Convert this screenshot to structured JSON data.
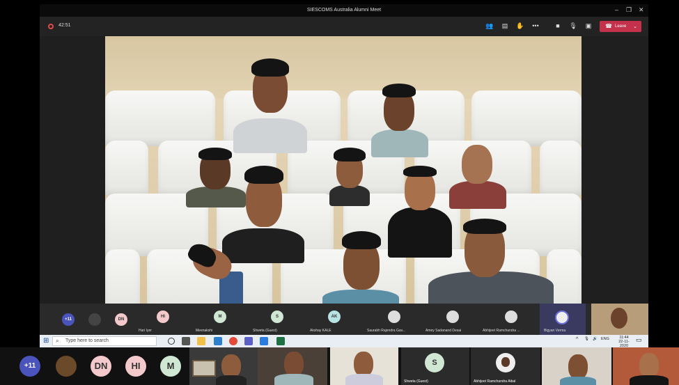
{
  "window": {
    "title": "SIESCOMS Australia Alumni Meet",
    "timer": "42:51",
    "leave_label": "Leave"
  },
  "strip": {
    "overflow": "+11",
    "participants": [
      {
        "initials": "DN",
        "name": ""
      },
      {
        "initials": "HI",
        "name": "Hari Iyer"
      },
      {
        "initials": "M",
        "name": "Meenakshi"
      },
      {
        "initials": "S",
        "name": "Shweta (Guest)"
      },
      {
        "initials": "AK",
        "name": "Akshay KALE"
      },
      {
        "initials": "",
        "name": "Saurabh Rajendra Gav..."
      },
      {
        "initials": "",
        "name": "Amey Sadanand Desai"
      },
      {
        "initials": "",
        "name": "Abhijeet Ramchandra ..."
      },
      {
        "initials": "",
        "name": "Bigyan Verma"
      }
    ]
  },
  "taskbar": {
    "search_placeholder": "Type here to search",
    "lang": "ENG",
    "time": "11:44",
    "date": "22-11-2020"
  },
  "outer": {
    "overflow": "+11",
    "circles": [
      "DN",
      "HI",
      "M"
    ],
    "tiles": [
      {
        "label": ""
      },
      {
        "label": ""
      },
      {
        "label": "S",
        "name": "Shweta (Guest)"
      },
      {
        "label": "",
        "name": "Abhijeet Ramchandra Aibal"
      }
    ]
  },
  "colors": {
    "leave": "#c4314b",
    "avatar_pink": "#f3c9cc",
    "avatar_green": "#cfe7d3",
    "avatar_teal": "#b9e3e3",
    "overflow": "#4b53bc"
  }
}
